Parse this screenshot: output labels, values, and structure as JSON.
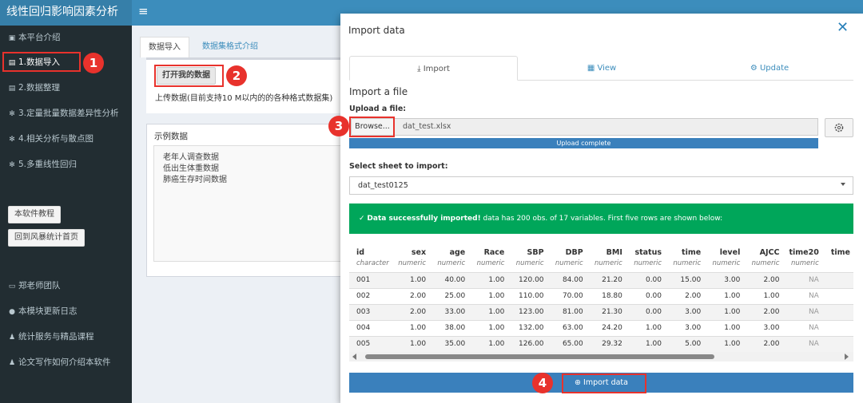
{
  "app": {
    "title": "线性回归影响因素分析",
    "menu_icon": "hamburger-icon"
  },
  "sidebar": {
    "items": [
      {
        "label": "本平台介绍",
        "icon": "dashboard-icon"
      },
      {
        "label": "1.数据导入",
        "icon": "database-icon"
      },
      {
        "label": "2.数据整理",
        "icon": "database-icon"
      },
      {
        "label": "3.定量批量数据差异性分析",
        "icon": "gears-icon"
      },
      {
        "label": "4.相关分析与散点图",
        "icon": "gears-icon"
      },
      {
        "label": "5.多重线性回归",
        "icon": "gears-icon"
      }
    ],
    "buttons": [
      "本软件教程",
      "回到风暴统计首页"
    ],
    "footer_items": [
      {
        "label": "郑老师团队",
        "icon": "desktop-icon"
      },
      {
        "label": "本模块更新日志",
        "icon": "info-icon"
      },
      {
        "label": "统计服务与精品课程",
        "icon": "users-icon"
      },
      {
        "label": "论文写作如何介绍本软件",
        "icon": "users-icon"
      }
    ]
  },
  "main": {
    "tabs": [
      "数据导入",
      "数据集格式介绍"
    ],
    "open_button": "打开我的数据",
    "upload_note": "上传数据(目前支持10 M以内的的各种格式数据集)",
    "example_title": "示例数据",
    "examples": [
      "老年人调查数据",
      "低出生体重数据",
      "肺癌生存时间数据"
    ]
  },
  "modal": {
    "title": "Import data",
    "tabs": [
      "Import",
      "View",
      "Update"
    ],
    "section_title": "Import a file",
    "upload_label": "Upload a file:",
    "browse_label": "Browse...",
    "file_name": "dat_test.xlsx",
    "progress_text": "Upload complete",
    "progress": 1.0,
    "sheet_label": "Select sheet to import:",
    "sheet_value": "dat_test0125",
    "alert_bold": "Data successfully imported!",
    "alert_text": " data has 200 obs. of 17 variables. First five rows are shown below:",
    "import_button": "Import data"
  },
  "table": {
    "columns": [
      {
        "name": "id",
        "type": "character"
      },
      {
        "name": "sex",
        "type": "numeric"
      },
      {
        "name": "age",
        "type": "numeric"
      },
      {
        "name": "Race",
        "type": "numeric"
      },
      {
        "name": "SBP",
        "type": "numeric"
      },
      {
        "name": "DBP",
        "type": "numeric"
      },
      {
        "name": "BMI",
        "type": "numeric"
      },
      {
        "name": "status",
        "type": "numeric"
      },
      {
        "name": "time",
        "type": "numeric"
      },
      {
        "name": "level",
        "type": "numeric"
      },
      {
        "name": "AJCC",
        "type": "numeric"
      },
      {
        "name": "time20",
        "type": "numeric"
      },
      {
        "name": "time",
        "type": ""
      }
    ],
    "rows": [
      [
        "001",
        "1.00",
        "40.00",
        "1.00",
        "120.00",
        "84.00",
        "21.20",
        "0.00",
        "15.00",
        "3.00",
        "2.00",
        "NA",
        ""
      ],
      [
        "002",
        "2.00",
        "25.00",
        "1.00",
        "110.00",
        "70.00",
        "18.80",
        "0.00",
        "2.00",
        "1.00",
        "1.00",
        "NA",
        ""
      ],
      [
        "003",
        "2.00",
        "33.00",
        "1.00",
        "123.00",
        "81.00",
        "21.30",
        "0.00",
        "3.00",
        "1.00",
        "2.00",
        "NA",
        ""
      ],
      [
        "004",
        "1.00",
        "38.00",
        "1.00",
        "132.00",
        "63.00",
        "24.20",
        "1.00",
        "3.00",
        "1.00",
        "3.00",
        "NA",
        ""
      ],
      [
        "005",
        "1.00",
        "35.00",
        "1.00",
        "126.00",
        "65.00",
        "29.32",
        "1.00",
        "5.00",
        "1.00",
        "2.00",
        "NA",
        ""
      ]
    ]
  },
  "annotations": [
    "1",
    "2",
    "3",
    "4"
  ],
  "colors": {
    "accent": "#3c8dbc",
    "sidebar": "#222d32",
    "success": "#00a65a",
    "highlight": "#e8322c"
  }
}
